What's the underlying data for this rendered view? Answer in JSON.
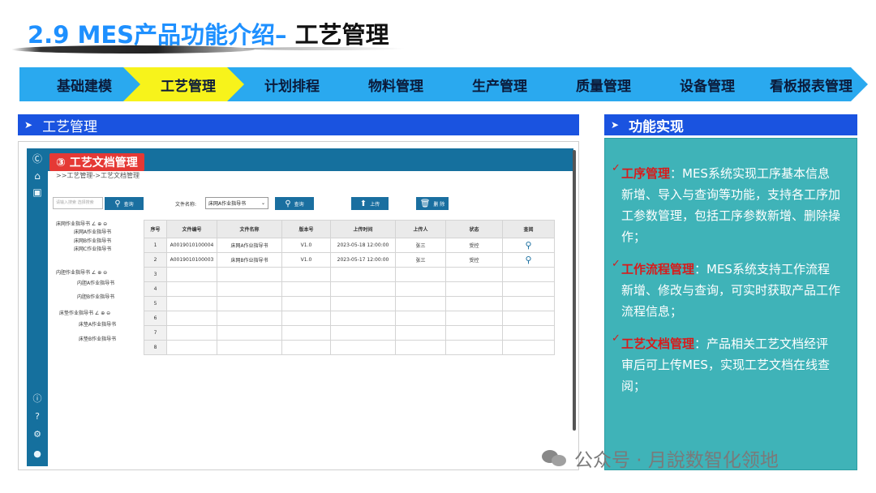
{
  "slide": {
    "title_num": "2.9 MES产品功能介绍–",
    "title_sub": "工艺管理"
  },
  "steps": [
    {
      "label": "基础建模",
      "active": false
    },
    {
      "label": "工艺管理",
      "active": true
    },
    {
      "label": "计划排程",
      "active": false
    },
    {
      "label": "物料管理",
      "active": false
    },
    {
      "label": "生产管理",
      "active": false
    },
    {
      "label": "质量管理",
      "active": false
    },
    {
      "label": "设备管理",
      "active": false
    },
    {
      "label": "看板报表管理",
      "active": false
    }
  ],
  "colors": {
    "accent": "#2aa9ef",
    "active": "#f7f31b",
    "header": "#1a53e0",
    "panel": "#3fb3b8",
    "highlight": "#d81b1b"
  },
  "left_panel": {
    "heading": "工艺管理",
    "app": {
      "badge": "③ 工艺文档管理",
      "breadcrumb": ">>工艺管理->工艺文档管理",
      "search_placeholder": "请输入搜索    选择搜索",
      "search_btn": "查询",
      "file_name_label": "文件名称:",
      "file_select": "床网A作业指导书",
      "query_btn": "查询",
      "upload_btn": "上传",
      "delete_btn": "删 除",
      "tree": [
        "床网作业指导书 ∠ ⊕ ⊖",
        "床网A作业指导书",
        "床网B作业指导书",
        "床网C作业指导书",
        "内胆作业指导书 ∠ ⊕ ⊖",
        "内胆A作业指导书",
        "内胆B作业指导书",
        "床垫作业指导书 ∠ ⊕ ⊖",
        "床垫A作业指导书",
        "床垫B作业指导书"
      ],
      "table": {
        "headers": [
          "序号",
          "文件编号",
          "文件名称",
          "版本号",
          "上传时间",
          "上传人",
          "状态",
          "查阅"
        ],
        "rows": [
          [
            "1",
            "A0019010100004",
            "床网A作业指导书",
            "V1.0",
            "2023-05-18 12:00:00",
            "张三",
            "受控",
            "search-icon"
          ],
          [
            "2",
            "A0019010100003",
            "床网B作业指导书",
            "V1.0",
            "2023-05-17 12:00:00",
            "张三",
            "受控",
            "search-icon"
          ],
          [
            "3",
            "",
            "",
            "",
            "",
            "",
            "",
            ""
          ],
          [
            "4",
            "",
            "",
            "",
            "",
            "",
            "",
            ""
          ],
          [
            "5",
            "",
            "",
            "",
            "",
            "",
            "",
            ""
          ],
          [
            "6",
            "",
            "",
            "",
            "",
            "",
            "",
            ""
          ],
          [
            "7",
            "",
            "",
            "",
            "",
            "",
            "",
            ""
          ],
          [
            "8",
            "",
            "",
            "",
            "",
            "",
            "",
            ""
          ]
        ]
      }
    }
  },
  "right_panel": {
    "heading": "功能实现",
    "features": [
      {
        "name": "工序管理",
        "text": "：MES系统实现工序基本信息新增、导入与查询等功能，支持各工序加工参数管理，包括工序参数新增、删除操作；"
      },
      {
        "name": "工作流程管理",
        "text": "：MES系统支持工作流程新增、修改与查询，可实时获取产品工作流程信息；"
      },
      {
        "name": "工艺文档管理",
        "text": "：产品相关工艺文档经评审后可上传MES，实现工艺文档在线查阅；"
      }
    ]
  },
  "watermark": "公众号 · 月說数智化领地"
}
